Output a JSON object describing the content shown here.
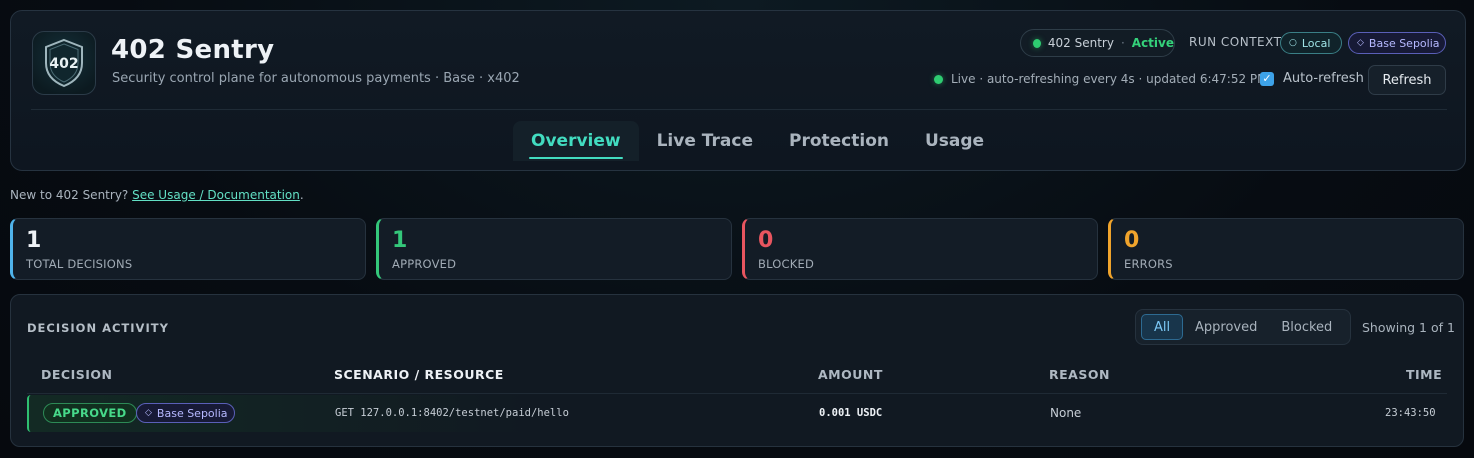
{
  "app": {
    "title": "402 Sentry",
    "subtitle": "Security control plane for autonomous payments · Base · x402",
    "logo_text": "402"
  },
  "status": {
    "name": "402 Sentry",
    "separator": "·",
    "state": "Active"
  },
  "run_context": {
    "label": "RUN CONTEXT",
    "local": "Local",
    "network": "Base Sepolia"
  },
  "live": {
    "text": "Live · auto-refreshing every 4s · updated 6:47:52 PM"
  },
  "auto_refresh": {
    "label": "Auto-refresh",
    "checked": true
  },
  "refresh_button": "Refresh",
  "tabs": [
    {
      "label": "Overview",
      "active": true
    },
    {
      "label": "Live Trace",
      "active": false
    },
    {
      "label": "Protection",
      "active": false
    },
    {
      "label": "Usage",
      "active": false
    }
  ],
  "doc": {
    "prefix": "New to 402 Sentry? ",
    "link": "See Usage / Documentation",
    "suffix": "."
  },
  "stats": [
    {
      "value": "1",
      "label": "TOTAL DECISIONS",
      "color": "#4fb3ea"
    },
    {
      "value": "1",
      "label": "APPROVED",
      "color": "#34c77a"
    },
    {
      "value": "0",
      "label": "BLOCKED",
      "color": "#e8555f"
    },
    {
      "value": "0",
      "label": "ERRORS",
      "color": "#f0a42c"
    }
  ],
  "activity": {
    "title": "DECISION ACTIVITY",
    "filters": [
      "All",
      "Approved",
      "Blocked"
    ],
    "active_filter": "All",
    "showing": "Showing 1 of 1",
    "columns": {
      "decision": "DECISION",
      "scenario": "SCENARIO / RESOURCE",
      "amount": "AMOUNT",
      "reason": "REASON",
      "time": "TIME"
    },
    "rows": [
      {
        "decision": "APPROVED",
        "network": "Base Sepolia",
        "resource": "GET 127.0.0.1:8402/testnet/paid/hello",
        "amount": "0.001 USDC",
        "reason": "None",
        "time": "23:43:50"
      }
    ]
  },
  "icons": {
    "logo": "shield-icon",
    "status_dot": "status-dot-icon",
    "live_dot": "live-dot-icon",
    "local": "circle-icon",
    "network": "diamond-icon",
    "checkbox": "checkmark-icon"
  }
}
